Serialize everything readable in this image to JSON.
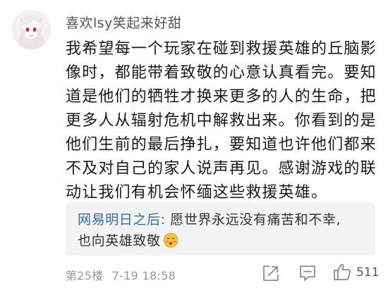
{
  "comment": {
    "username": "喜欢lsy笑起来好甜",
    "body_lines": [
      "我希望每一个玩家在碰到救援英雄的丘脑影",
      "像时，都能带着致敬的心意认真看完。要知",
      "道是他们的牺牲才换来更多的人的生命，把",
      "更多人从辐射危机中解救出来。你看到的是",
      "他们生前的最后挣扎，要知道也许他们都来",
      "不及对自己的家人说声再见。感谢游戏的联",
      "动让我们有机会怀缅这些救援英雄。"
    ]
  },
  "reply": {
    "author": "网易明日之后:",
    "line1_text": " 愿世界永远没有痛苦和不幸,",
    "line2_text": "也向英雄致敬",
    "emoji": "blushing-face-emoji"
  },
  "footer": {
    "floor": "第25楼",
    "timestamp": "7-19 18:58",
    "like_count": "511"
  },
  "icons": {
    "share": "share-icon",
    "comment": "comment-icon",
    "like": "thumbs-up-icon"
  },
  "colors": {
    "reply_author": "#3b6aa3",
    "reply_background": "#f3f3f3"
  }
}
